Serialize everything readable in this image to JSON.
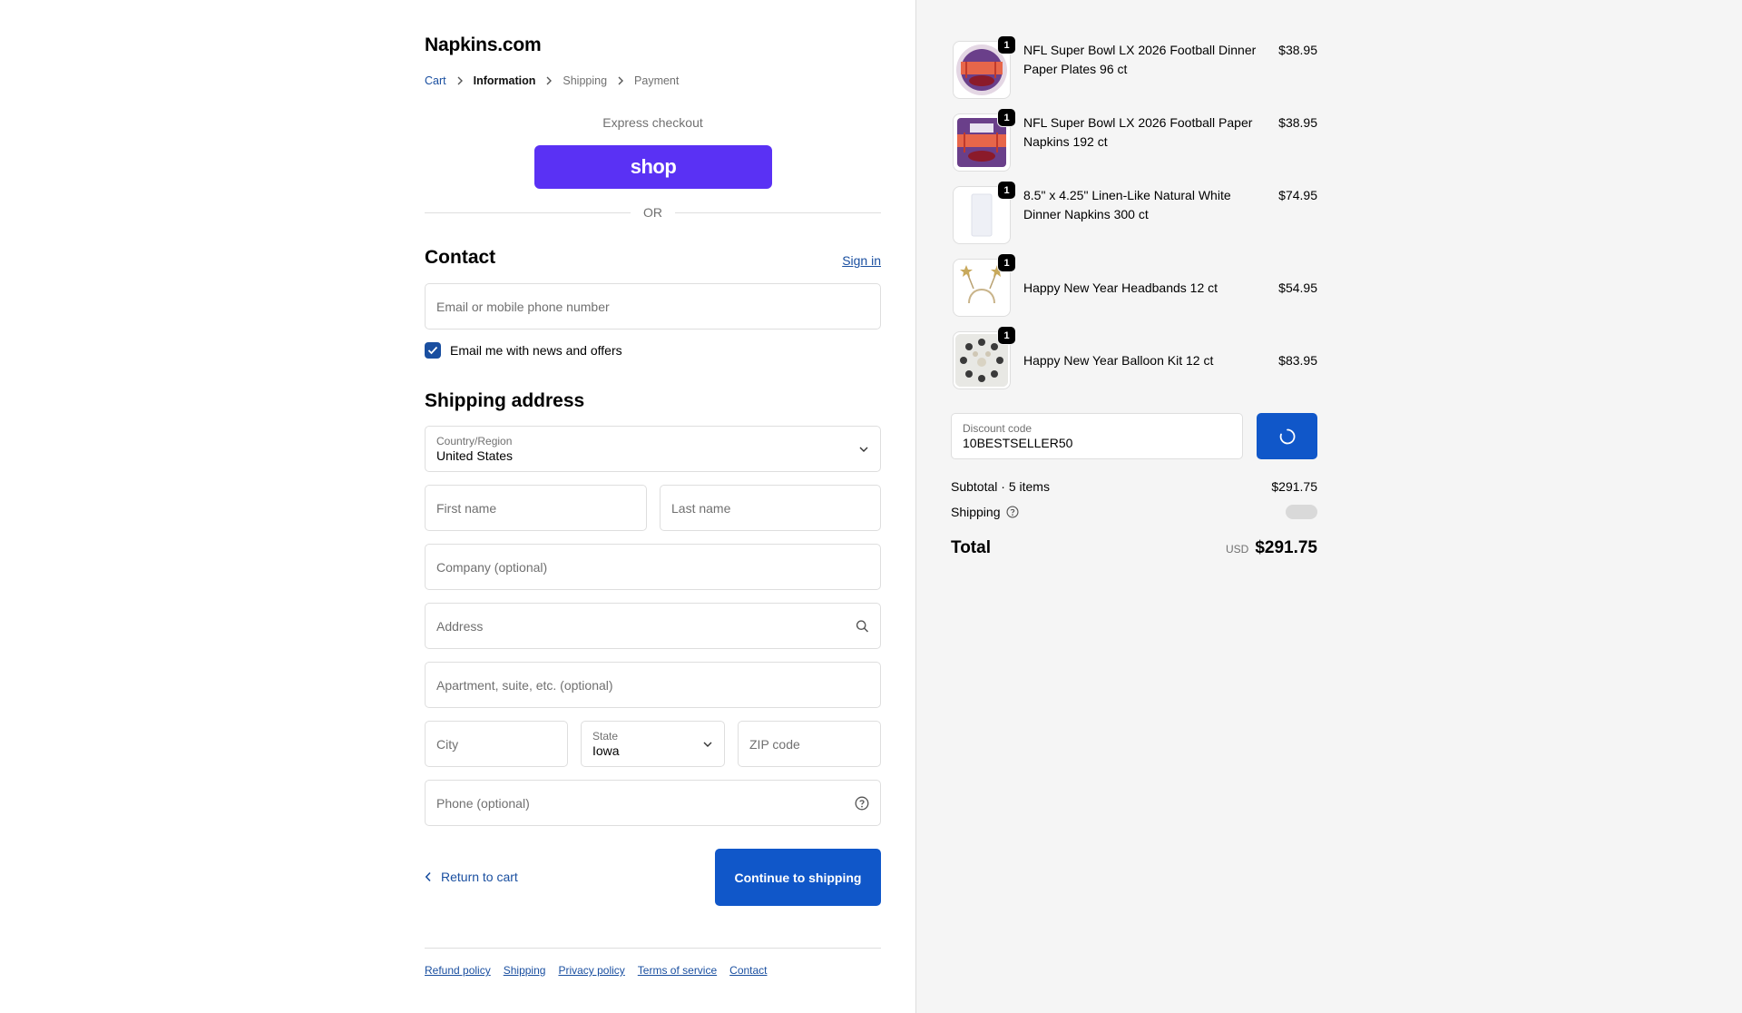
{
  "store": {
    "title": "Napkins.com"
  },
  "breadcrumb": [
    "Cart",
    "Information",
    "Shipping",
    "Payment"
  ],
  "express": {
    "label": "Express checkout",
    "shop_label": "shop",
    "or_label": "OR"
  },
  "contact": {
    "title": "Contact",
    "sign_in": "Sign in",
    "email_placeholder": "Email or mobile phone number",
    "newsletter_label": "Email me with news and offers",
    "newsletter_checked": true
  },
  "shipping": {
    "title": "Shipping address",
    "country_label": "Country/Region",
    "country_value": "United States",
    "first_name_placeholder": "First name",
    "last_name_placeholder": "Last name",
    "company_placeholder": "Company (optional)",
    "address_placeholder": "Address",
    "apartment_placeholder": "Apartment, suite, etc. (optional)",
    "city_placeholder": "City",
    "state_label": "State",
    "state_value": "Iowa",
    "zip_placeholder": "ZIP code",
    "phone_placeholder": "Phone (optional)"
  },
  "actions": {
    "return_label": "Return to cart",
    "continue_label": "Continue to shipping"
  },
  "footer": {
    "links": [
      "Refund policy",
      "Shipping",
      "Privacy policy",
      "Terms of service",
      "Contact"
    ]
  },
  "order": {
    "items": [
      {
        "name": "NFL Super Bowl LX 2026 Football Dinner Paper Plates 96 ct",
        "price": "$38.95",
        "qty": "1",
        "icon": "plate-image"
      },
      {
        "name": "NFL Super Bowl LX 2026 Football Paper Napkins 192 ct",
        "price": "$38.95",
        "qty": "1",
        "icon": "napkin-image"
      },
      {
        "name": "8.5\" x 4.25\" Linen-Like Natural White Dinner Napkins 300 ct",
        "price": "$74.95",
        "qty": "1",
        "icon": "white-napkin-image"
      },
      {
        "name": "Happy New Year Headbands 12 ct",
        "price": "$54.95",
        "qty": "1",
        "icon": "headband-image"
      },
      {
        "name": "Happy New Year Balloon Kit 12 ct",
        "price": "$83.95",
        "qty": "1",
        "icon": "balloon-kit-image"
      }
    ],
    "discount_label": "Discount code",
    "discount_value": "10BESTSELLER50",
    "subtotal_label": "Subtotal · 5 items",
    "subtotal_value": "$291.75",
    "shipping_label": "Shipping",
    "total_label": "Total",
    "total_currency": "USD",
    "total_value": "$291.75"
  },
  "colors": {
    "accent": "#1057c9",
    "shop": "#5a31f4",
    "link": "#1a4fa0"
  }
}
